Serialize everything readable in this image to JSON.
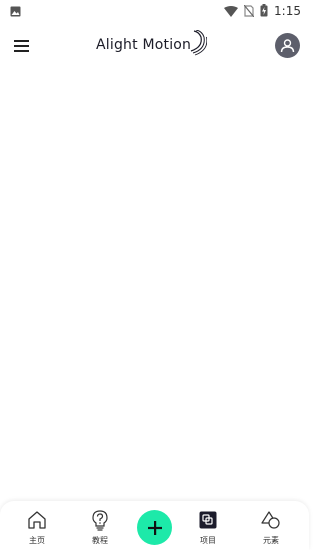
{
  "status_bar": {
    "time": "1:15",
    "icons": [
      "image-icon",
      "wifi-icon",
      "no-sim-icon",
      "battery-charging-icon"
    ]
  },
  "app_bar": {
    "logo_text": "Alight Motion",
    "menu_icon": "hamburger-menu-icon",
    "account_icon": "account-icon"
  },
  "bottom_nav": {
    "items": [
      {
        "label": "主页",
        "icon": "home-icon"
      },
      {
        "label": "教程",
        "icon": "lightbulb-question-icon"
      },
      {
        "label": "",
        "icon": "plus-icon"
      },
      {
        "label": "项目",
        "icon": "projects-icon"
      },
      {
        "label": "元素",
        "icon": "elements-shapes-icon"
      }
    ],
    "fab_color": "#1de9a9"
  }
}
